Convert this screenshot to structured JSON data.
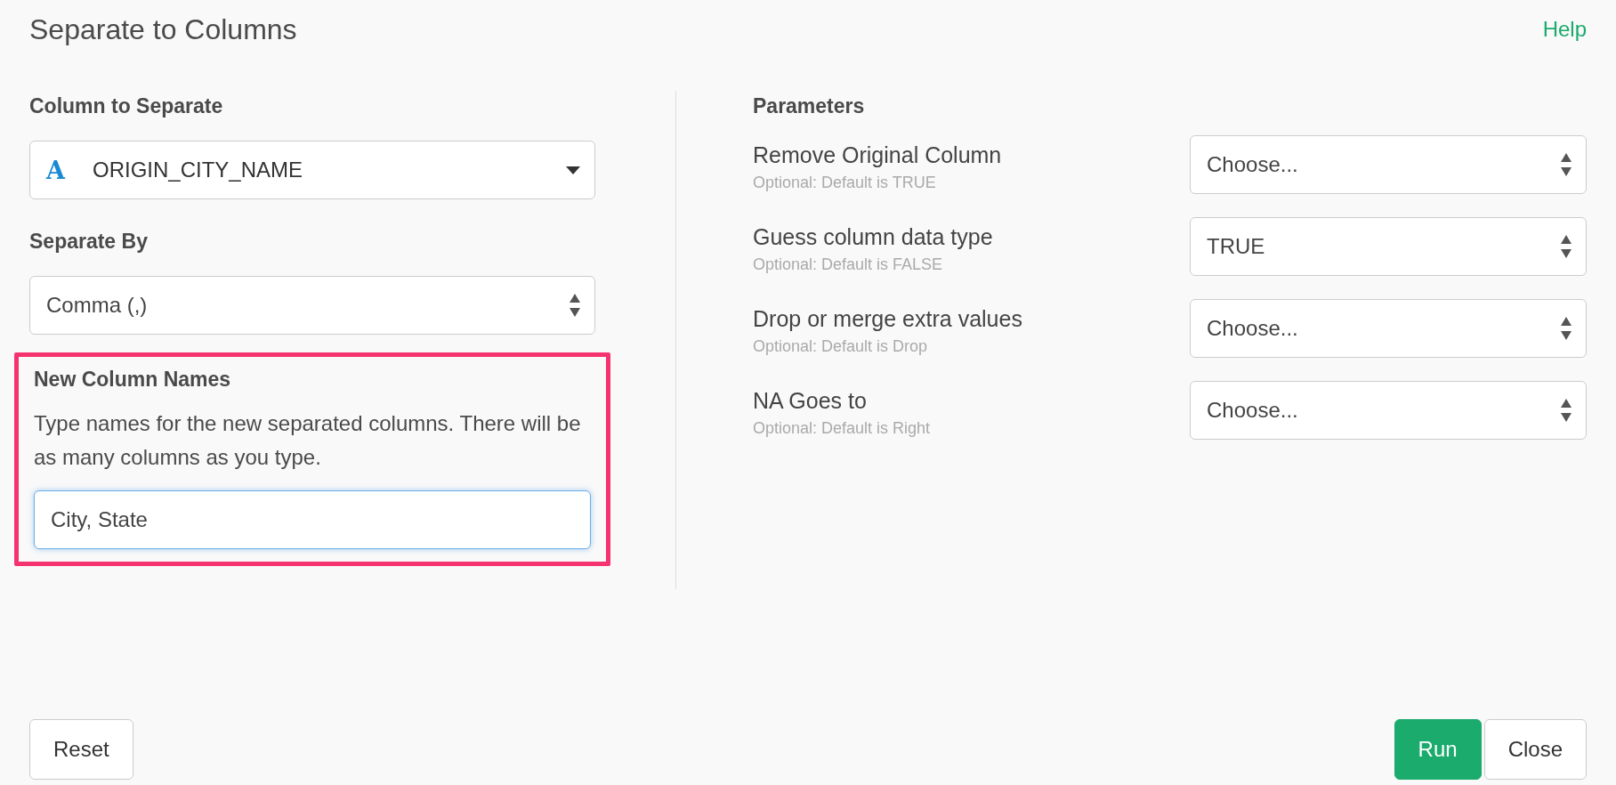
{
  "dialog": {
    "title": "Separate to Columns",
    "help_link": "Help"
  },
  "column_to_separate": {
    "label": "Column to Separate",
    "type_icon": "A",
    "value": "ORIGIN_CITY_NAME"
  },
  "separate_by": {
    "label": "Separate By",
    "value": "Comma (,)"
  },
  "new_column_names": {
    "label": "New Column Names",
    "description": "Type names for the new separated columns. There will be as many columns as you type.",
    "value": "City, State",
    "highlighted": true,
    "focused": true
  },
  "parameters": {
    "label": "Parameters",
    "rows": [
      {
        "name": "Remove Original Column",
        "hint": "Optional: Default is TRUE",
        "value": "Choose..."
      },
      {
        "name": "Guess column data type",
        "hint": "Optional: Default is FALSE",
        "value": "TRUE"
      },
      {
        "name": "Drop or merge extra values",
        "hint": "Optional: Default is Drop",
        "value": "Choose..."
      },
      {
        "name": "NA Goes to",
        "hint": "Optional: Default is Right",
        "value": "Choose..."
      }
    ]
  },
  "buttons": {
    "left": [
      "Reset"
    ],
    "right": [
      {
        "label": "Run",
        "kind": "primary"
      },
      {
        "label": "Close",
        "kind": "default"
      }
    ]
  }
}
